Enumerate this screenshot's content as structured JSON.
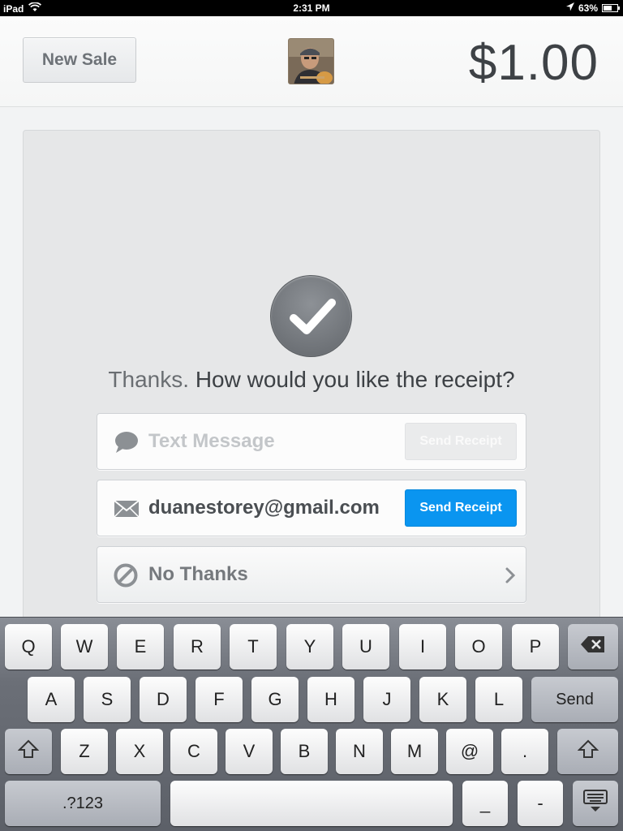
{
  "status_bar": {
    "device": "iPad",
    "time": "2:31 PM",
    "battery": "63%",
    "battery_level": 0.63
  },
  "header": {
    "new_sale_label": "New Sale",
    "total": "$1.00"
  },
  "receipt": {
    "thanks": "Thanks.",
    "question": "How would you like the receipt?",
    "sms": {
      "placeholder": "Text Message",
      "button": "Send Receipt"
    },
    "email": {
      "value": "duanestorey@gmail.com",
      "button": "Send Receipt"
    },
    "no_thanks": "No Thanks"
  },
  "colors": {
    "accent": "#0a95f0",
    "total_text": "#3e4246"
  },
  "keyboard": {
    "row1": [
      "Q",
      "W",
      "E",
      "R",
      "T",
      "Y",
      "U",
      "I",
      "O",
      "P"
    ],
    "row2": [
      "A",
      "S",
      "D",
      "F",
      "G",
      "H",
      "J",
      "K",
      "L"
    ],
    "row3": [
      "Z",
      "X",
      "C",
      "V",
      "B",
      "N",
      "M",
      "@",
      "."
    ],
    "send": "Send",
    "numbers": ".?123",
    "underscore": "_",
    "dash": "-",
    "icons": [
      "backspace-icon",
      "shift-icon",
      "keyboard-hide-icon"
    ]
  }
}
